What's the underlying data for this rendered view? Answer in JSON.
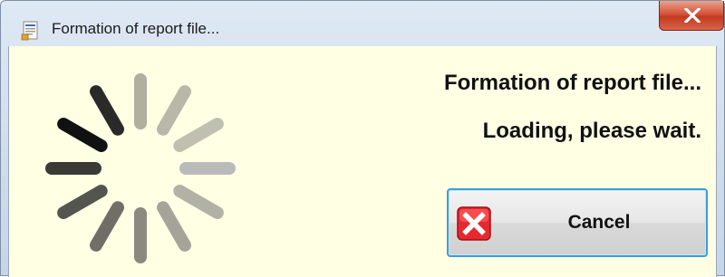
{
  "window": {
    "title": "Formation of report file...",
    "icons": {
      "app": "report-document-icon",
      "close": "close-x-icon",
      "cancel": "red-x-icon"
    },
    "colors": {
      "client_background": "#ffffe4",
      "close_button": "#c94a2f",
      "button_border": "#3c9ed8",
      "cancel_icon": "#e8282f"
    }
  },
  "dialog": {
    "message_title": "Formation of report file...",
    "message_status": "Loading, please wait.",
    "cancel_label": "Cancel",
    "spinner_icon": "loading-spinner-icon"
  }
}
